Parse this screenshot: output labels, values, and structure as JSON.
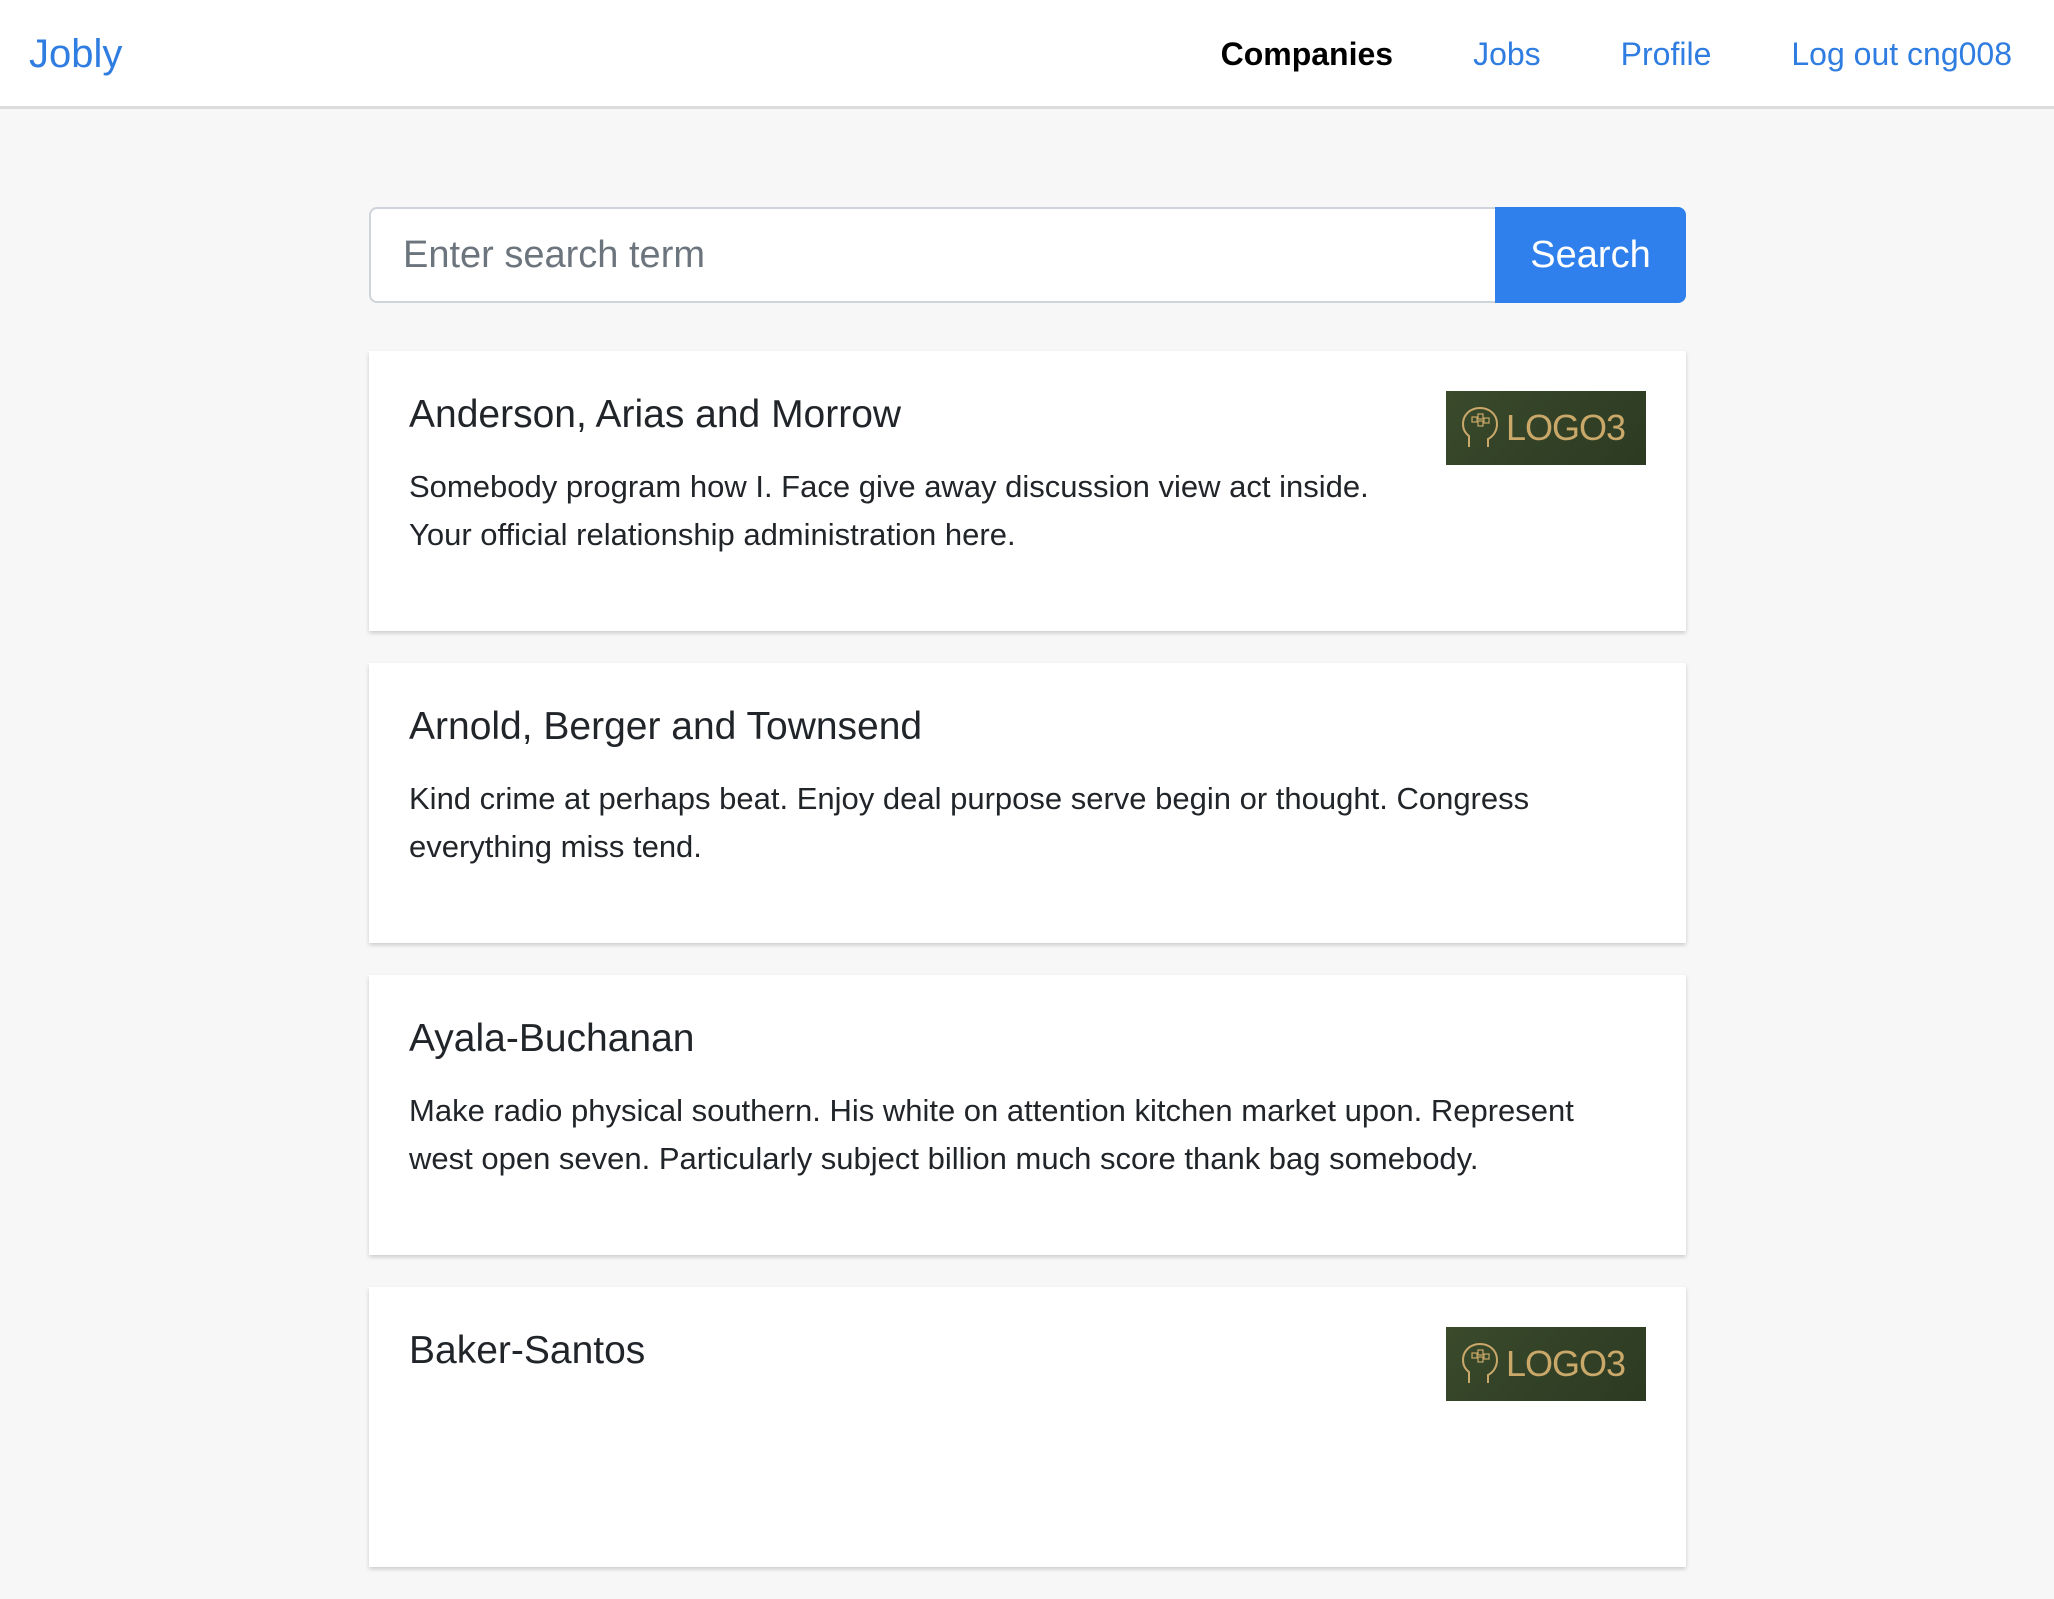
{
  "nav": {
    "brand": "Jobly",
    "links": [
      "Companies",
      "Jobs",
      "Profile",
      "Log out cng008"
    ]
  },
  "search": {
    "placeholder": "Enter search term",
    "button_label": "Search"
  },
  "companies": [
    {
      "name": "Anderson, Arias and Morrow",
      "description": "Somebody program how I. Face give away discussion view act inside. Your official relationship administration here.",
      "logo": "LOGO3"
    },
    {
      "name": "Arnold, Berger and Townsend",
      "description": "Kind crime at perhaps beat. Enjoy deal purpose serve begin or thought. Congress everything miss tend."
    },
    {
      "name": "Ayala-Buchanan",
      "description": "Make radio physical southern. His white on attention kitchen market upon. Represent west open seven. Particularly subject billion much score thank bag somebody."
    },
    {
      "name": "Baker-Santos",
      "description": "",
      "logo": "LOGO3"
    }
  ],
  "colors": {
    "accent": "#2f80ed",
    "link": "#2f7de1",
    "background": "#f7f7f7",
    "logo_bg": "#33432a",
    "logo_gold": "#c9a86a"
  }
}
